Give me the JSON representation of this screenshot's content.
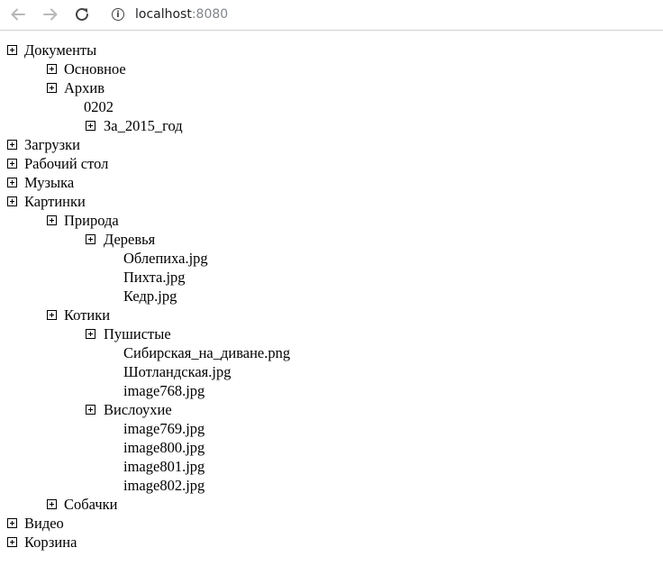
{
  "browser": {
    "url_host": "localhost",
    "url_port": ":8080"
  },
  "tree": {
    "documents": "Документы",
    "basic": "Основное",
    "archive": "Архив",
    "archive_0202": "0202",
    "archive_2015": "За_2015_год",
    "downloads": "Загрузки",
    "desktop": "Рабочий стол",
    "music": "Музыка",
    "pictures": "Картинки",
    "nature": "Природа",
    "trees": "Деревья",
    "file_oblepikha": "Облепиха.jpg",
    "file_pikhta": "Пихта.jpg",
    "file_kedr": "Кедр.jpg",
    "cats": "Котики",
    "fluffy": "Пушистые",
    "file_sibirskaya": "Сибирская_на_диване.png",
    "file_shotlandskaya": "Шотландская.jpg",
    "file_image768": "image768.jpg",
    "lop_eared": "Вислоухие",
    "file_image769": "image769.jpg",
    "file_image800": "image800.jpg",
    "file_image801": "image801.jpg",
    "file_image802": "image802.jpg",
    "dogs": "Собачки",
    "video": "Видео",
    "trash": "Корзина"
  }
}
